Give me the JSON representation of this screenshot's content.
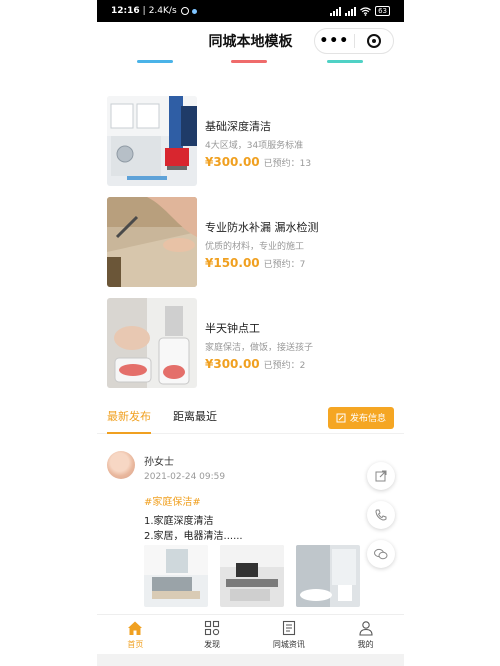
{
  "status_bar": {
    "time": "12:16",
    "speed": "2.4K/s",
    "battery": "63"
  },
  "header": {
    "title": "同城本地模板",
    "more_label": "•••"
  },
  "colors": {
    "accent": "#f0a020",
    "pill_blue": "#4ab3e8",
    "pill_red": "#ef6b6b",
    "pill_teal": "#4fd1c5"
  },
  "services": [
    {
      "name": "基础深度清洁",
      "desc": "4大区域，34项服务标准",
      "price": "¥300.00",
      "booked": "已预约：13"
    },
    {
      "name": "专业防水补漏 漏水检测",
      "desc": "优质的材料，专业的施工",
      "price": "¥150.00",
      "booked": "已预约：7"
    },
    {
      "name": "半天钟点工",
      "desc": "家庭保洁，做饭，接送孩子",
      "price": "¥300.00",
      "booked": "已预约：2"
    }
  ],
  "tabs": [
    {
      "label": "最新发布"
    },
    {
      "label": "距离最近"
    }
  ],
  "publish_button": {
    "label": "发布信息"
  },
  "post": {
    "author": "孙女士",
    "time": "2021-02-24 09:59",
    "tag": "#家庭保洁#",
    "lines": [
      "1.家庭深度清洁",
      "2.家居，电器清洁......"
    ]
  },
  "bottom_nav": [
    {
      "label": "首页",
      "icon": "home-icon"
    },
    {
      "label": "发现",
      "icon": "discover-icon"
    },
    {
      "label": "同城资讯",
      "icon": "news-icon"
    },
    {
      "label": "我的",
      "icon": "profile-icon"
    }
  ]
}
